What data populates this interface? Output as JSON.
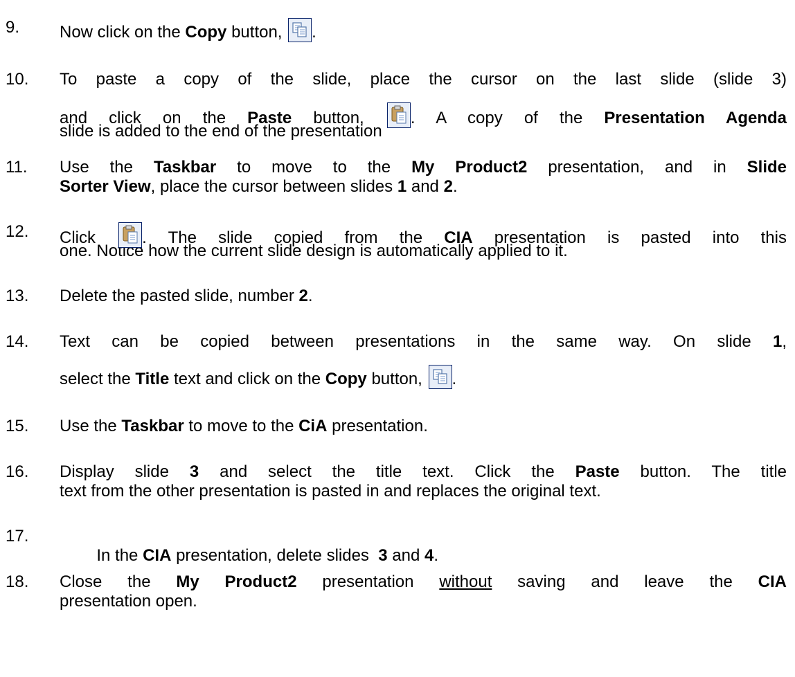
{
  "steps": [
    {
      "num": "9.",
      "parts": [
        "Now click on the ",
        "Copy",
        " button, ",
        "."
      ]
    },
    {
      "num": "10.",
      "line1": "To paste a copy of the slide, place the cursor on the last slide (slide 3)",
      "line2_parts": [
        "and click on the ",
        "Paste",
        " button, ",
        ". A copy of the ",
        "Presentation Agenda"
      ],
      "line3": "slide is added to the end of the presentation"
    },
    {
      "num": "11.",
      "line1_parts": [
        "Use the ",
        "Taskbar",
        " to move to the ",
        "My Product2",
        " presentation, and in ",
        "Slide"
      ],
      "line2_parts": [
        "Sorter View",
        ", place the cursor between slides ",
        "1",
        " and ",
        "2",
        "."
      ]
    },
    {
      "num": "12.",
      "line1_parts": [
        "Click ",
        ". The slide copied from the ",
        "CIA",
        " presentation is pasted into this"
      ],
      "line2": "one. Notice how the current slide design is automatically applied to it."
    },
    {
      "num": "13.",
      "parts": [
        "Delete the pasted slide, number ",
        "2",
        "."
      ]
    },
    {
      "num": "14.",
      "line1_parts": [
        "Text can be copied between presentations in the same way.  On slide ",
        "1",
        ","
      ],
      "line2_parts": [
        "select the ",
        "Title",
        " text and click on the ",
        "Copy",
        " button, ",
        "."
      ]
    },
    {
      "num": "15.",
      "parts": [
        "Use the ",
        "Taskbar",
        " to move to the ",
        "CiA",
        " presentation."
      ]
    },
    {
      "num": "16.",
      "line1_parts": [
        "Display slide ",
        "3",
        " and select the title text. Click the ",
        "Paste",
        " button. The title"
      ],
      "line2": "text from the other presentation is pasted in and replaces the original text."
    },
    {
      "num": "17.",
      "parts": [
        "In the ",
        "CIA",
        " presentation, delete slides  ",
        "3",
        " and ",
        "4",
        "."
      ]
    },
    {
      "num": "18.",
      "line1_parts": [
        "Close the ",
        "My Product2",
        " presentation ",
        "without",
        " saving and leave the ",
        "CIA"
      ],
      "line2": "presentation open."
    }
  ],
  "icons": {
    "copy": "copy-icon",
    "paste": "paste-icon",
    "border_color": "#0a246a",
    "fill_color": "#e8eef8"
  }
}
